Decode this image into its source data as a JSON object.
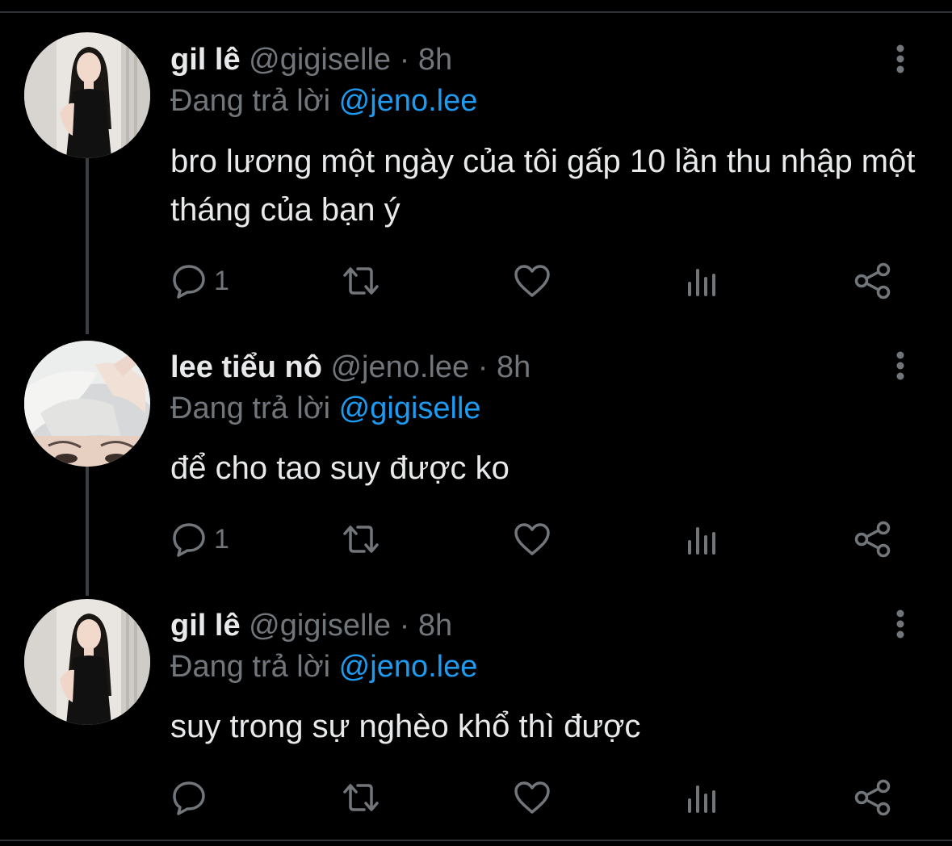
{
  "tweets": [
    {
      "name": "gil lê",
      "handle": "@gigiselle",
      "separator": "·",
      "time": "8h",
      "reply_prefix": "Đang trả lời",
      "reply_to": "@jeno.lee",
      "text": "bro lương một ngày của tôi gấp 10 lần thu nhập một tháng của bạn ý",
      "reply_count": "1",
      "avatar_icon": "avatar-woman-black-dress"
    },
    {
      "name": "lee tiểu nô",
      "handle": "@jeno.lee",
      "separator": "·",
      "time": "8h",
      "reply_prefix": "Đang trả lời",
      "reply_to": "@gigiselle",
      "text": "để cho tao suy được ko",
      "reply_count": "1",
      "avatar_icon": "avatar-silver-hair"
    },
    {
      "name": "gil lê",
      "handle": "@gigiselle",
      "separator": "·",
      "time": "8h",
      "reply_prefix": "Đang trả lời",
      "reply_to": "@jeno.lee",
      "text": "suy trong sự nghèo khổ thì được",
      "reply_count": "",
      "avatar_icon": "avatar-woman-black-dress"
    }
  ],
  "icons": {
    "reply": "reply-icon",
    "retweet": "retweet-icon",
    "like": "like-icon",
    "views": "views-icon",
    "share": "share-icon",
    "more": "more-icon"
  },
  "colors": {
    "background": "#000000",
    "text_primary": "#e7e9ea",
    "text_secondary": "#71767b",
    "mention": "#1d9bf0",
    "thread_line": "#3a3d41"
  }
}
